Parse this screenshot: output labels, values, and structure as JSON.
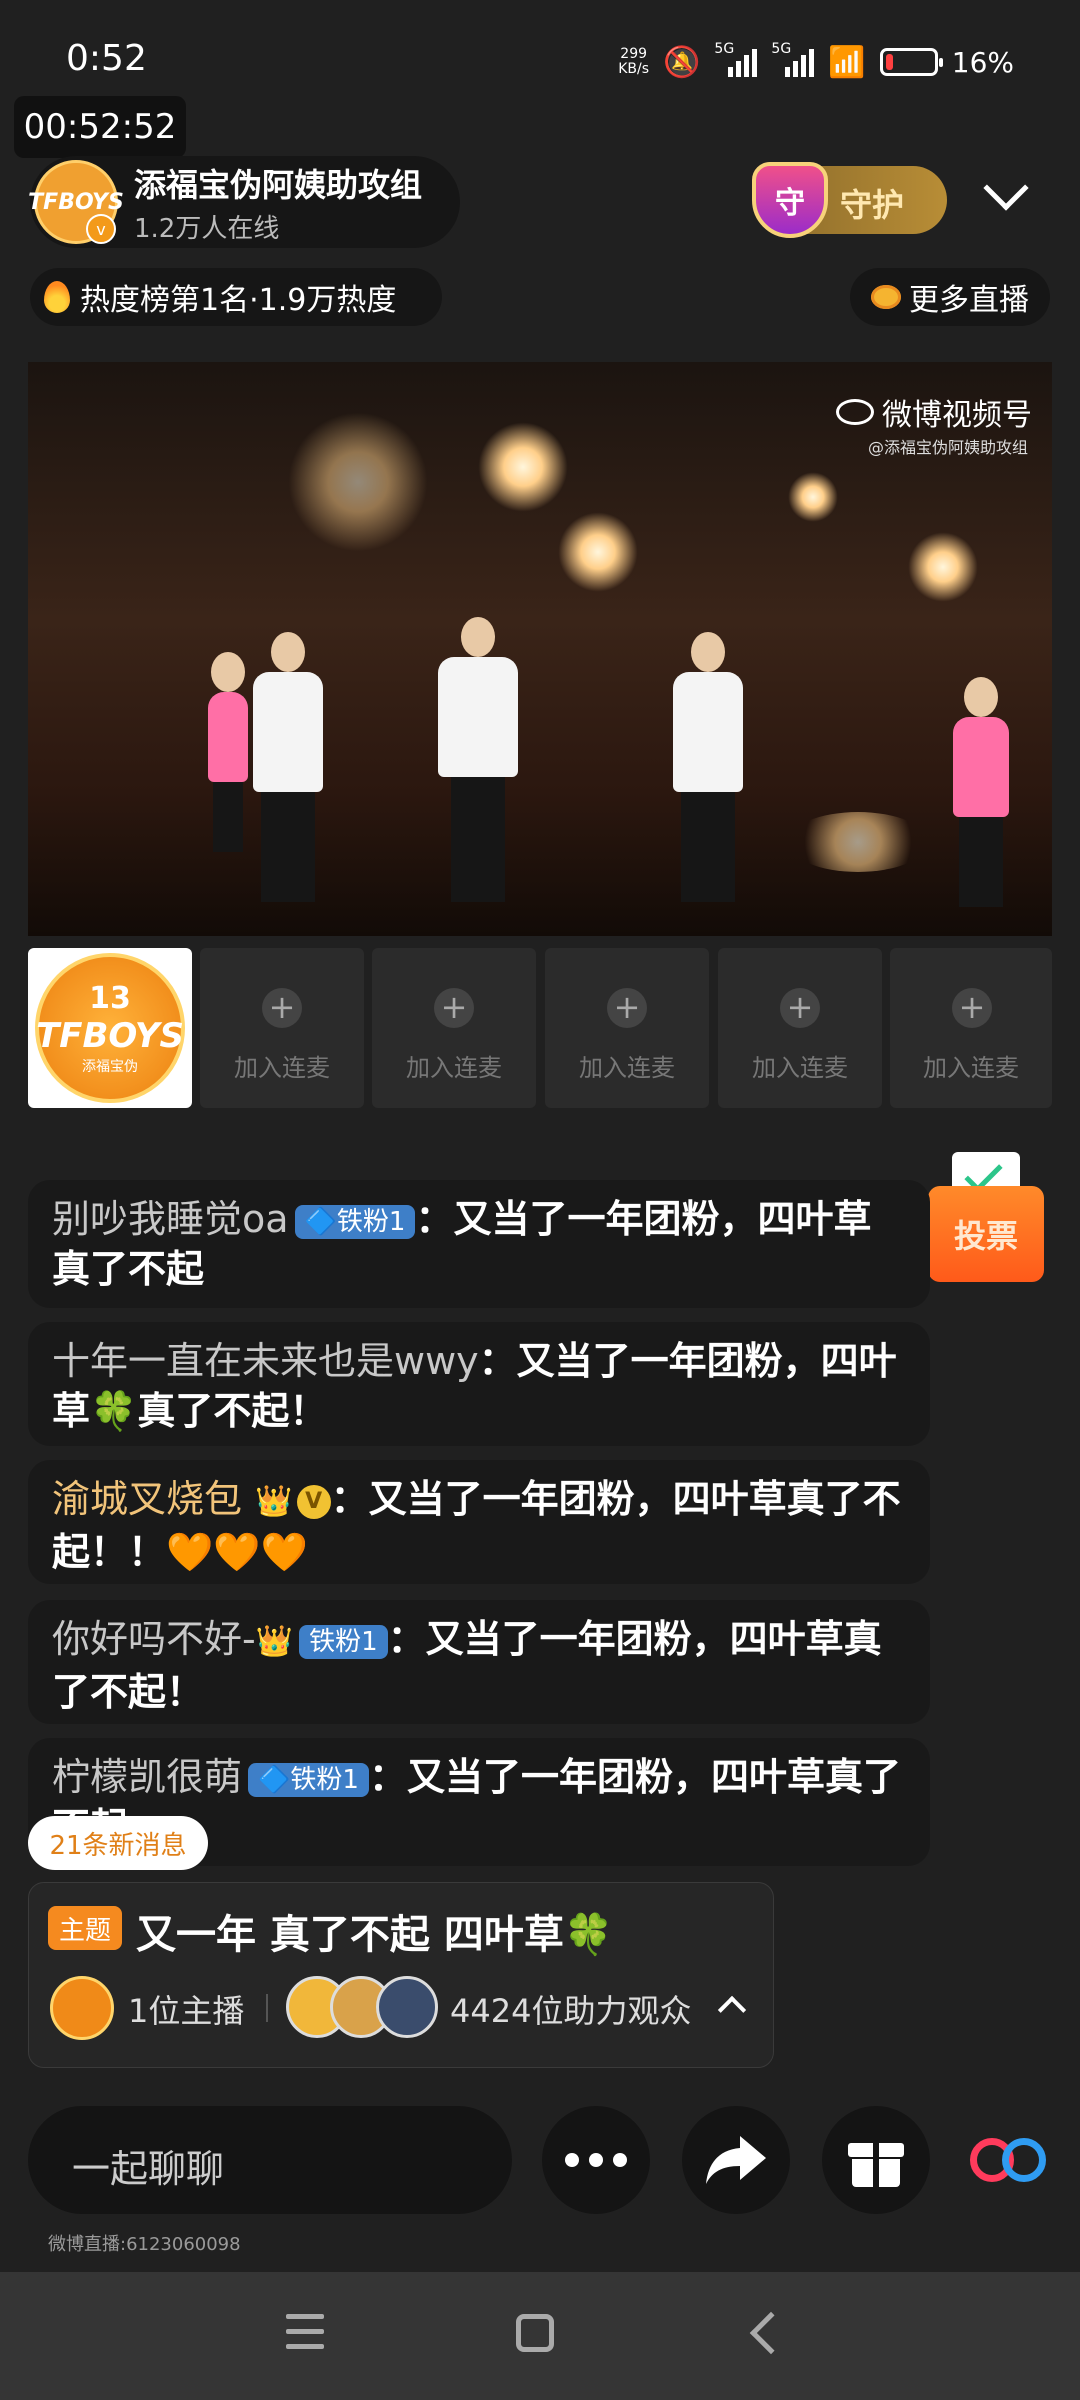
{
  "status_bar": {
    "time": "0:52",
    "net_speed_value": "299",
    "net_speed_unit": "KB/s",
    "sim1": "5G",
    "sim2": "5G",
    "battery": "16%",
    "battery_level": 0.16
  },
  "timer": "00:52:52",
  "host": {
    "name": "添福宝伪阿姨助攻组",
    "online": "1.2万人在线",
    "avatar_text": "TFBOYS"
  },
  "guard": {
    "label": "守护",
    "shield_char": "守"
  },
  "heat": {
    "text": "热度榜第1名·1.9万热度"
  },
  "more_live": {
    "label": "更多直播"
  },
  "video": {
    "watermark": "微博视频号",
    "watermark_sub": "@添福宝伪阿姨助攻组"
  },
  "cohost": {
    "main": {
      "num": "13",
      "brand": "TFBOYS",
      "sub": "添福宝伪"
    },
    "slot_label": "加入连麦",
    "slot_plus": "+"
  },
  "vote": {
    "label": "投票"
  },
  "chat": [
    {
      "nick": "别吵我睡觉oa",
      "badge": "🔷铁粉1",
      "text": "：又当了一年团粉，四叶草真了不起"
    },
    {
      "nick": "十年一直在未来也是wwy",
      "text": "：又当了一年团粉，四叶草🍀真了不起！"
    },
    {
      "nick": "渝城叉烧包",
      "crown": "👑",
      "vbadge": "V",
      "text": "：又当了一年团粉，四叶草真了不起！！",
      "hearts": "🧡🧡🧡"
    },
    {
      "nick": "你好吗不好-",
      "crown": "👑",
      "badge": "铁粉1",
      "text": "：又当了一年团粉，四叶草真了不起！"
    },
    {
      "nick": "柠檬凯很萌",
      "badge": "🔷铁粉1",
      "text": "：又当了一年团粉，四叶草真了不起"
    }
  ],
  "new_messages": "21条新消息",
  "topic": {
    "tag": "主题",
    "title": "又一年 真了不起 四叶草🍀",
    "host_count": "1位主播",
    "audience_count": "4424位助力观众"
  },
  "bottom": {
    "input_placeholder": "一起聊聊",
    "weibo_id": "微博直播:6123060098"
  },
  "colors": {
    "accent": "#f58a1f",
    "badge_blue": "#3e7fc8",
    "background": "#202020"
  }
}
